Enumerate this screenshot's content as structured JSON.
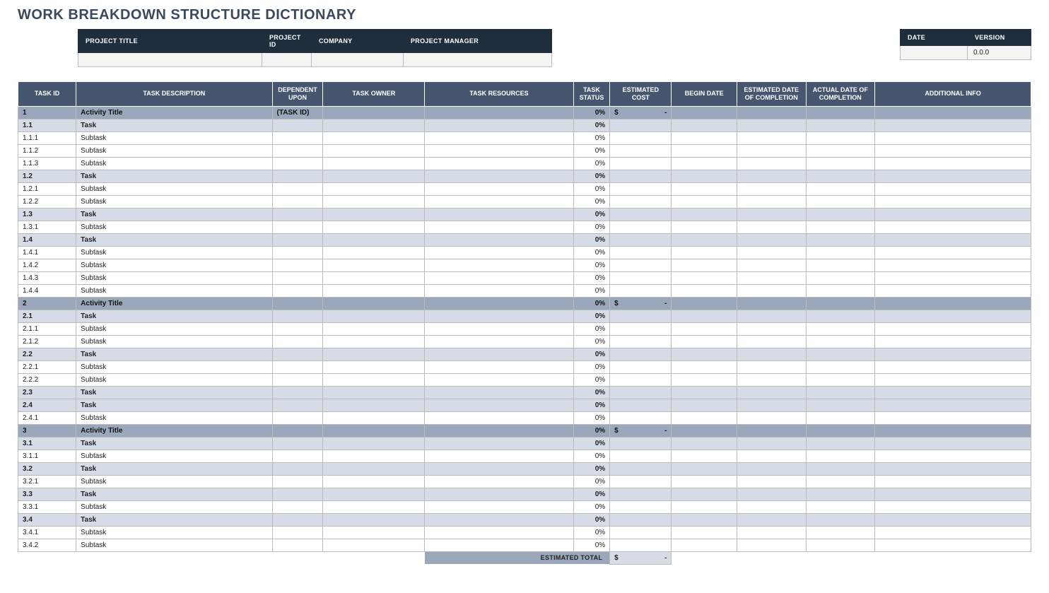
{
  "title": "WORK BREAKDOWN STRUCTURE DICTIONARY",
  "project": {
    "headers": {
      "title": "PROJECT TITLE",
      "id": "PROJECT ID",
      "company": "COMPANY",
      "manager": "PROJECT MANAGER",
      "date": "DATE",
      "version": "VERSION"
    },
    "values": {
      "title": "",
      "id": "",
      "company": "",
      "manager": "",
      "date": "",
      "version": "0.0.0"
    }
  },
  "columns": {
    "task_id": "TASK ID",
    "description": "TASK DESCRIPTION",
    "dependent": "DEPENDENT UPON",
    "owner": "TASK OWNER",
    "resources": "TASK RESOURCES",
    "status": "TASK STATUS",
    "cost": "ESTIMATED COST",
    "begin": "BEGIN DATE",
    "est_completion": "ESTIMATED DATE OF COMPLETION",
    "act_completion": "ACTUAL DATE OF COMPLETION",
    "info": "ADDITIONAL INFO"
  },
  "rows": [
    {
      "level": "activity",
      "id": "1",
      "desc": "Activity Title",
      "dep": "(TASK ID)",
      "status": "0%",
      "cost": "$ -"
    },
    {
      "level": "task",
      "id": "1.1",
      "desc": "Task",
      "status": "0%"
    },
    {
      "level": "subtask",
      "id": "1.1.1",
      "desc": "Subtask",
      "status": "0%"
    },
    {
      "level": "subtask",
      "id": "1.1.2",
      "desc": "Subtask",
      "status": "0%"
    },
    {
      "level": "subtask",
      "id": "1.1.3",
      "desc": "Subtask",
      "status": "0%"
    },
    {
      "level": "task",
      "id": "1.2",
      "desc": "Task",
      "status": "0%"
    },
    {
      "level": "subtask",
      "id": "1.2.1",
      "desc": "Subtask",
      "status": "0%"
    },
    {
      "level": "subtask",
      "id": "1.2.2",
      "desc": "Subtask",
      "status": "0%"
    },
    {
      "level": "task",
      "id": "1.3",
      "desc": "Task",
      "status": "0%"
    },
    {
      "level": "subtask",
      "id": "1.3.1",
      "desc": "Subtask",
      "status": "0%"
    },
    {
      "level": "task",
      "id": "1.4",
      "desc": "Task",
      "status": "0%"
    },
    {
      "level": "subtask",
      "id": "1.4.1",
      "desc": "Subtask",
      "status": "0%"
    },
    {
      "level": "subtask",
      "id": "1.4.2",
      "desc": "Subtask",
      "status": "0%"
    },
    {
      "level": "subtask",
      "id": "1.4.3",
      "desc": "Subtask",
      "status": "0%"
    },
    {
      "level": "subtask",
      "id": "1.4.4",
      "desc": "Subtask",
      "status": "0%"
    },
    {
      "level": "activity",
      "id": "2",
      "desc": "Activity Title",
      "status": "0%",
      "cost": "$ -"
    },
    {
      "level": "task",
      "id": "2.1",
      "desc": "Task",
      "status": "0%"
    },
    {
      "level": "subtask",
      "id": "2.1.1",
      "desc": "Subtask",
      "status": "0%"
    },
    {
      "level": "subtask",
      "id": "2.1.2",
      "desc": "Subtask",
      "status": "0%"
    },
    {
      "level": "task",
      "id": "2.2",
      "desc": "Task",
      "status": "0%"
    },
    {
      "level": "subtask",
      "id": "2.2.1",
      "desc": "Subtask",
      "status": "0%"
    },
    {
      "level": "subtask",
      "id": "2.2.2",
      "desc": "Subtask",
      "status": "0%"
    },
    {
      "level": "task",
      "id": "2.3",
      "desc": "Task",
      "status": "0%"
    },
    {
      "level": "task",
      "id": "2.4",
      "desc": "Task",
      "status": "0%"
    },
    {
      "level": "subtask",
      "id": "2.4.1",
      "desc": "Subtask",
      "status": "0%"
    },
    {
      "level": "activity",
      "id": "3",
      "desc": "Activity Title",
      "status": "0%",
      "cost": "$ -"
    },
    {
      "level": "task",
      "id": "3.1",
      "desc": "Task",
      "status": "0%"
    },
    {
      "level": "subtask",
      "id": "3.1.1",
      "desc": "Subtask",
      "status": "0%"
    },
    {
      "level": "task",
      "id": "3.2",
      "desc": "Task",
      "status": "0%"
    },
    {
      "level": "subtask",
      "id": "3.2.1",
      "desc": "Subtask",
      "status": "0%"
    },
    {
      "level": "task",
      "id": "3.3",
      "desc": "Task",
      "status": "0%"
    },
    {
      "level": "subtask",
      "id": "3.3.1",
      "desc": "Subtask",
      "status": "0%"
    },
    {
      "level": "task",
      "id": "3.4",
      "desc": "Task",
      "status": "0%"
    },
    {
      "level": "subtask",
      "id": "3.4.1",
      "desc": "Subtask",
      "status": "0%"
    },
    {
      "level": "subtask",
      "id": "3.4.2",
      "desc": "Subtask",
      "status": "0%"
    }
  ],
  "total": {
    "label": "ESTIMATED TOTAL",
    "value": "$ -"
  }
}
